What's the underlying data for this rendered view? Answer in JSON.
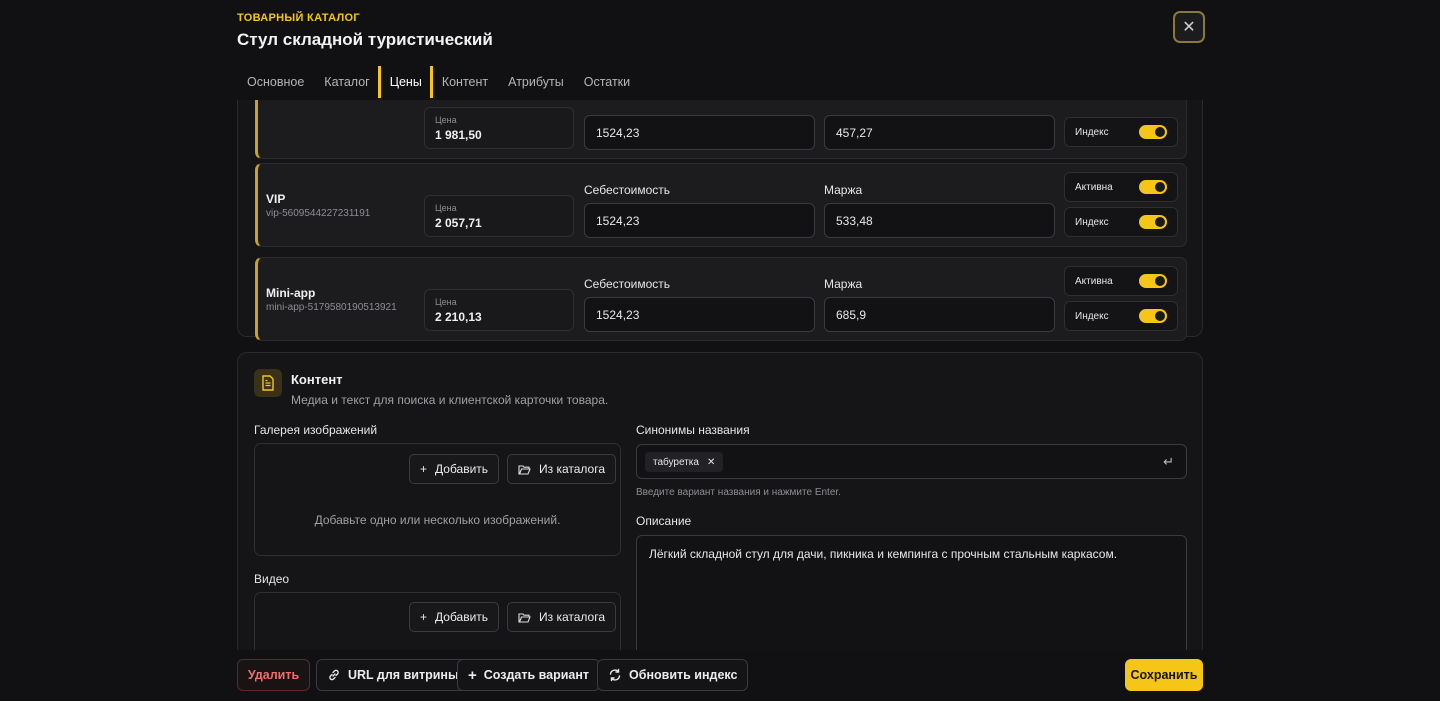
{
  "header": {
    "eyebrow": "ТОВАРНЫЙ КАТАЛОГ",
    "title": "Стул складной туристический"
  },
  "tabs": [
    {
      "label": "Основное"
    },
    {
      "label": "Каталог"
    },
    {
      "label": "Цены"
    },
    {
      "label": "Контент"
    },
    {
      "label": "Атрибуты"
    },
    {
      "label": "Остатки"
    }
  ],
  "prices": {
    "price_label": "Цена",
    "cost_label": "Себестоимость",
    "margin_label": "Маржа",
    "active_label": "Активна",
    "index_label": "Индекс",
    "rows": [
      {
        "name": "",
        "code": "",
        "price": "1 981,50",
        "cost": "1524,23",
        "margin": "457,27"
      },
      {
        "name": "VIP",
        "code": "vip-5609544227231191",
        "price": "2 057,71",
        "cost": "1524,23",
        "margin": "533,48"
      },
      {
        "name": "Mini-app",
        "code": "mini-app-5179580190513921",
        "price": "2 210,13",
        "cost": "1524,23",
        "margin": "685,9"
      }
    ]
  },
  "content": {
    "title": "Контент",
    "subtitle": "Медиа и текст для поиска и клиентской карточки товара.",
    "gallery_label": "Галерея изображений",
    "add_label": "Добавить",
    "from_catalog_label": "Из каталога",
    "gallery_hint": "Добавьте одно или несколько изображений.",
    "video_label": "Видео",
    "synonyms_label": "Синонимы названия",
    "synonym_chip": "табуретка",
    "synonyms_hint": "Введите вариант названия и нажмите Enter.",
    "description_label": "Описание",
    "description": "Лёгкий складной стул для дачи, пикника и кемпинга с прочным стальным каркасом."
  },
  "footer": {
    "delete": "Удалить",
    "url": "URL для витрины",
    "create_variant": "Создать вариант",
    "refresh_index": "Обновить индекс",
    "save": "Сохранить"
  },
  "colors": {
    "accent": "#f5c518",
    "danger": "#f26d6d",
    "background": "#111113"
  }
}
